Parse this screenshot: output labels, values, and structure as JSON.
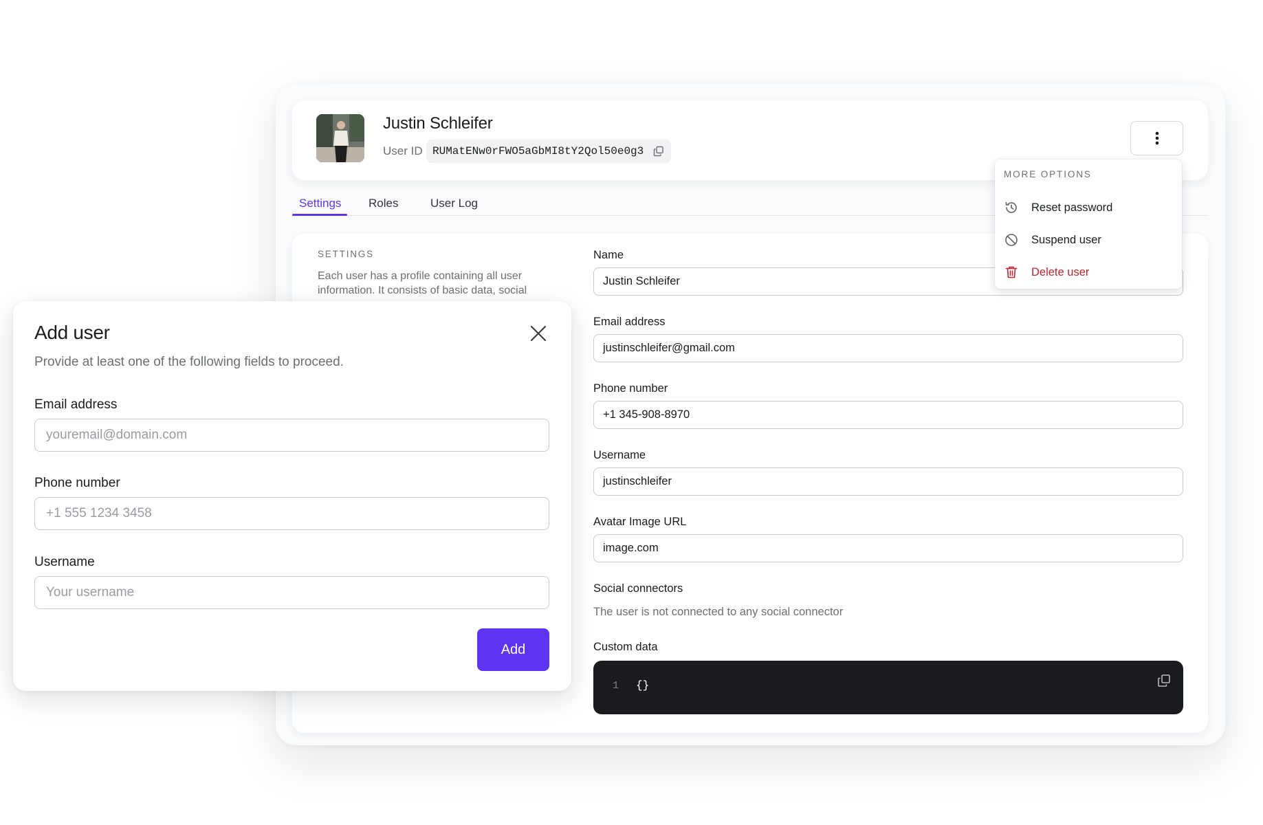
{
  "user": {
    "name": "Justin Schleifer",
    "id_label": "User ID",
    "id_value": "RUMatENw0rFWO5aGbMI8tY2Qol50e0g3"
  },
  "tabs": [
    {
      "label": "Settings",
      "active": true
    },
    {
      "label": "Roles",
      "active": false
    },
    {
      "label": "User Log",
      "active": false
    }
  ],
  "settings": {
    "section_label": "SETTINGS",
    "description": "Each user has a profile containing all user information. It consists of basic data, social"
  },
  "form": {
    "name": {
      "label": "Name",
      "value": "Justin Schleifer"
    },
    "email": {
      "label": "Email address",
      "value": "justinschleifer@gmail.com"
    },
    "phone": {
      "label": "Phone number",
      "value": "+1 345-908-8970"
    },
    "username": {
      "label": "Username",
      "value": "justinschleifer"
    },
    "avatar_url": {
      "label": "Avatar Image URL",
      "value": "image.com"
    },
    "social": {
      "label": "Social connectors",
      "note": "The user is not connected to any social connector"
    },
    "custom_data": {
      "label": "Custom data",
      "line_number": "1",
      "content": "{}"
    }
  },
  "more_options": {
    "title": "MORE OPTIONS",
    "items": [
      {
        "label": "Reset password",
        "icon": "history-icon",
        "danger": false
      },
      {
        "label": "Suspend user",
        "icon": "block-icon",
        "danger": false
      },
      {
        "label": "Delete user",
        "icon": "trash-icon",
        "danger": true
      }
    ]
  },
  "add_user_modal": {
    "title": "Add user",
    "subtitle": "Provide at least one of the following fields to proceed.",
    "email": {
      "label": "Email address",
      "placeholder": "youremail@domain.com"
    },
    "phone": {
      "label": "Phone number",
      "placeholder": "+1 555 1234 3458"
    },
    "username": {
      "label": "Username",
      "placeholder": "Your username"
    },
    "submit_label": "Add"
  },
  "colors": {
    "accent": "#5d34f2",
    "danger": "#c0232b",
    "code_bg": "#1a1b1e"
  }
}
